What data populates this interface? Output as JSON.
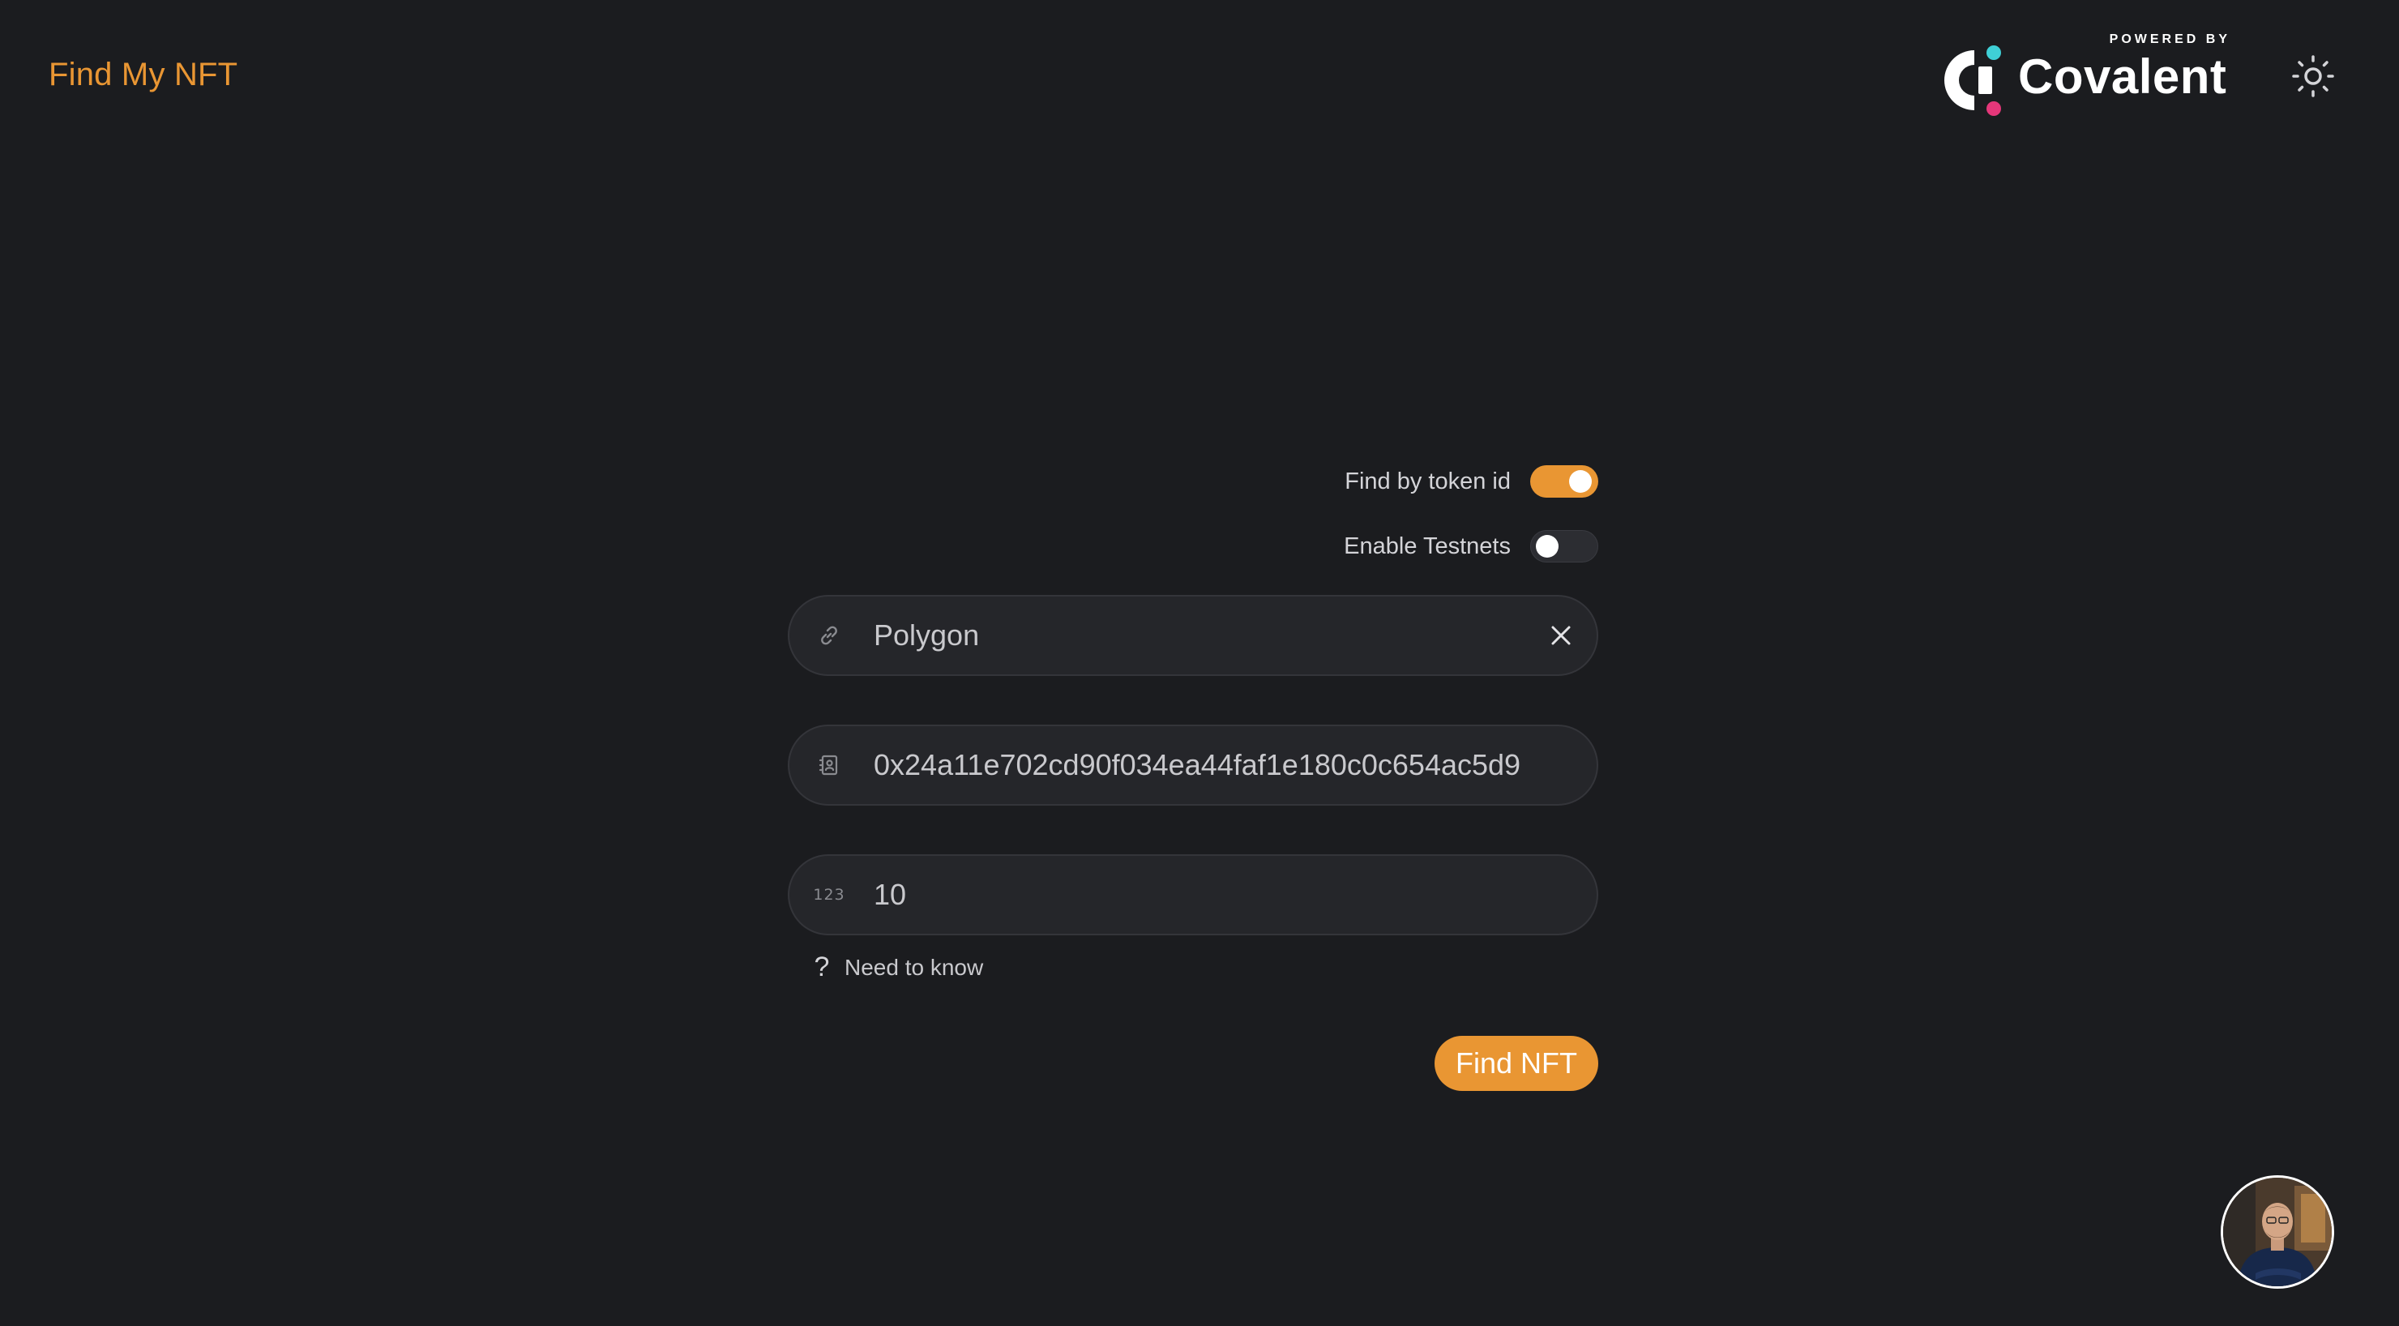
{
  "header": {
    "app_title": "Find My NFT",
    "brand": {
      "powered_by": "POWERED BY",
      "name": "Covalent",
      "logo_colors": {
        "teal": "#3fcfd6",
        "pink": "#e5377a"
      }
    },
    "theme_toggle_icon": "sun-icon"
  },
  "form": {
    "toggles": [
      {
        "label": "Find by token id",
        "state": "on"
      },
      {
        "label": "Enable Testnets",
        "state": "off"
      }
    ],
    "chain_field": {
      "icon": "link-icon",
      "value": "Polygon",
      "clear_icon": "close-icon"
    },
    "address_field": {
      "icon": "contact-card-icon",
      "value": "0x24a11e702cd90f034ea44faf1e180c0c654ac5d9"
    },
    "token_id_field": {
      "icon": "numbers-icon",
      "icon_text": "123",
      "value": "10"
    },
    "help": {
      "icon": "question-icon",
      "icon_text": "?",
      "label": "Need to know"
    },
    "submit_label": "Find NFT"
  },
  "colors": {
    "accent": "#e99633",
    "background": "#1b1c1f",
    "field_bg": "#25262a"
  }
}
